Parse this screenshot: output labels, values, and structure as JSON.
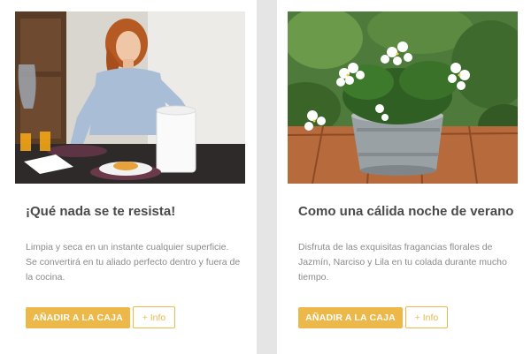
{
  "colors": {
    "page_background": "#e5e5e5",
    "card_background": "#ffffff",
    "accent": "#ecb84a",
    "title_text": "#4a4a4a",
    "body_text": "#8a8a8a"
  },
  "cards": [
    {
      "image_subject": "woman-cleaning-table-photo",
      "title": "¡Qué nada se te resista!",
      "description": "Limpia y seca en un instante cualquier superficie. Se convertirá en tu aliado perfecto dentro y fuera de la cocina.",
      "add_label": "AÑADIR A LA CAJA",
      "info_label": "+ Info"
    },
    {
      "image_subject": "jasmine-flowers-in-metal-bucket-photo",
      "title": "Como una cálida noche de verano",
      "description": "Disfruta de las exquisitas fragancias florales de Jazmín, Narciso y Lila en tu colada durante mucho tiempo.",
      "add_label": "AÑADIR A LA CAJA",
      "info_label": "+ Info"
    }
  ]
}
